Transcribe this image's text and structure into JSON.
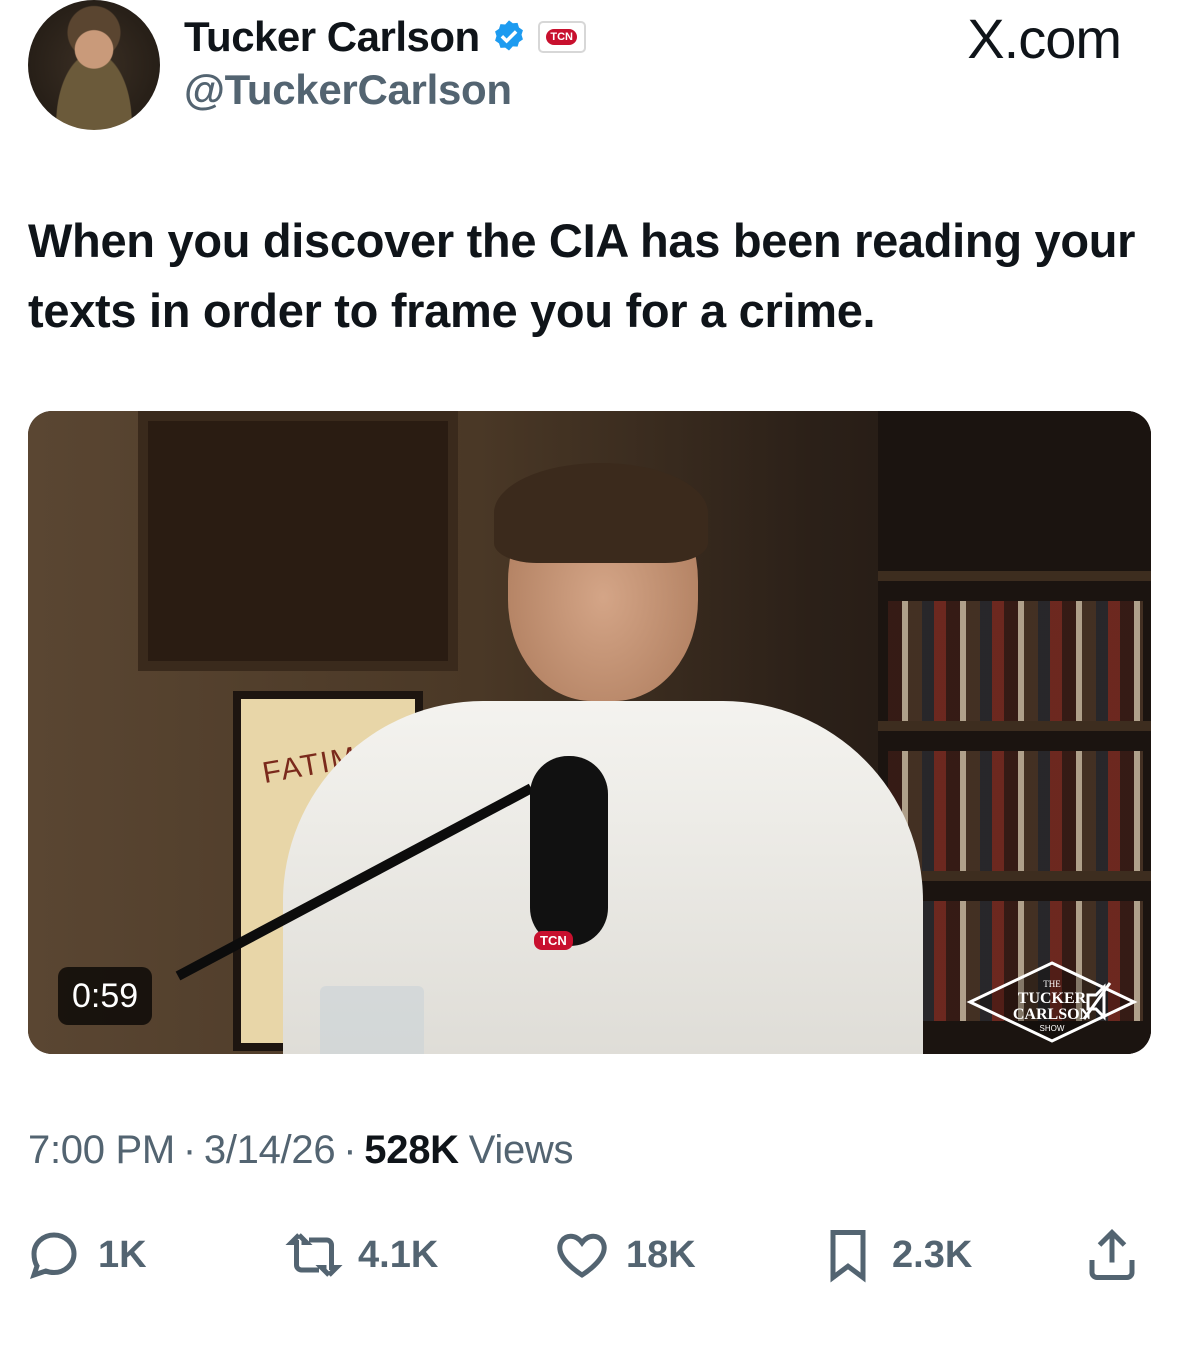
{
  "author": {
    "display_name": "Tucker Carlson",
    "handle": "@TuckerCarlson",
    "affiliate_badge": "TCN"
  },
  "site_label": "X.com",
  "tweet": {
    "text": "When you discover the CIA has been reading your texts in order to frame you for a crime."
  },
  "media": {
    "duration": "0:59",
    "poster_label": "FATIMA",
    "mic_label": "TCN",
    "show_logo": {
      "line1": "THE",
      "line2": "TUCKER",
      "line3": "CARLSON",
      "line4": "SHOW"
    }
  },
  "meta": {
    "time": "7:00 PM",
    "separator": "·",
    "date": "3/14/26",
    "views_count": "528K",
    "views_label": "Views"
  },
  "actions": {
    "replies": "1K",
    "reposts": "4.1K",
    "likes": "18K",
    "bookmarks": "2.3K"
  },
  "colors": {
    "verified": "#1d9bf0",
    "text_primary": "#0f1419",
    "text_secondary": "#536471",
    "badge_red": "#c8102e"
  },
  "icons": [
    "verified-icon",
    "reply-icon",
    "repost-icon",
    "like-icon",
    "bookmark-icon",
    "share-icon",
    "mute-icon"
  ]
}
